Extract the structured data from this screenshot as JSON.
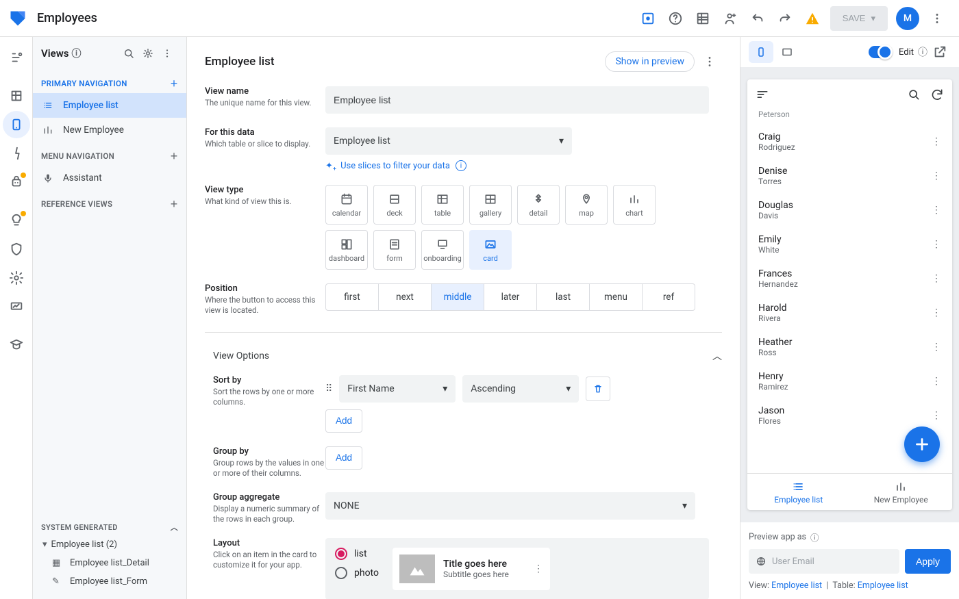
{
  "app": {
    "title": "Employees",
    "avatar_initial": "M",
    "save_label": "SAVE"
  },
  "views_panel": {
    "title": "Views",
    "sections": {
      "primary": {
        "title": "PRIMARY NAVIGATION",
        "items": [
          {
            "label": "Employee list",
            "icon": "list",
            "active": true
          },
          {
            "label": "New Employee",
            "icon": "chart",
            "active": false
          }
        ]
      },
      "menu": {
        "title": "MENU NAVIGATION",
        "items": [
          {
            "label": "Assistant",
            "icon": "mic"
          }
        ]
      },
      "ref": {
        "title": "REFERENCE VIEWS",
        "items": []
      },
      "sysgen": {
        "title": "SYSTEM GENERATED",
        "group_label": "Employee list (2)",
        "items": [
          {
            "label": "Employee list_Detail"
          },
          {
            "label": "Employee list_Form"
          }
        ]
      }
    }
  },
  "editor": {
    "title": "Employee list",
    "show_in_preview": "Show in preview",
    "fields": {
      "view_name": {
        "label": "View name",
        "hint": "The unique name for this view.",
        "value": "Employee list"
      },
      "for_data": {
        "label": "For this data",
        "hint": "Which table or slice to display.",
        "value": "Employee list",
        "slice_link": "Use slices to filter your data"
      },
      "view_type": {
        "label": "View type",
        "hint": "What kind of view this is.",
        "options": [
          "calendar",
          "deck",
          "table",
          "gallery",
          "detail",
          "map",
          "chart",
          "dashboard",
          "form",
          "onboarding",
          "card"
        ],
        "selected": "card"
      },
      "position": {
        "label": "Position",
        "hint": "Where the button to access this view is located.",
        "options": [
          "first",
          "next",
          "middle",
          "later",
          "last",
          "menu",
          "ref"
        ],
        "selected": "middle"
      }
    },
    "options_title": "View Options",
    "sort_by": {
      "label": "Sort by",
      "hint": "Sort the rows by one or more columns.",
      "column": "First Name",
      "direction": "Ascending",
      "add_label": "Add"
    },
    "group_by": {
      "label": "Group by",
      "hint": "Group rows by the values in one or more of their columns.",
      "add_label": "Add"
    },
    "group_agg": {
      "label": "Group aggregate",
      "hint": "Display a numeric summary of the rows in each group.",
      "value": "NONE"
    },
    "layout": {
      "label": "Layout",
      "hint": "Click on an item in the card to customize it for your app.",
      "radios": [
        "list",
        "photo"
      ],
      "selected": "list",
      "card_title": "Title goes here",
      "card_subtitle": "Subtitle goes here"
    }
  },
  "preview": {
    "edit_label": "Edit",
    "list": [
      {
        "first": "Peterson",
        "last": "",
        "partial": true
      },
      {
        "first": "Craig",
        "last": "Rodriguez"
      },
      {
        "first": "Denise",
        "last": "Torres"
      },
      {
        "first": "Douglas",
        "last": "Davis"
      },
      {
        "first": "Emily",
        "last": "White"
      },
      {
        "first": "Frances",
        "last": "Hernandez"
      },
      {
        "first": "Harold",
        "last": "Rivera"
      },
      {
        "first": "Heather",
        "last": "Ross"
      },
      {
        "first": "Henry",
        "last": "Ramirez"
      },
      {
        "first": "Jason",
        "last": "Flores"
      }
    ],
    "tabs": [
      {
        "label": "Employee list",
        "active": true
      },
      {
        "label": "New Employee",
        "active": false
      }
    ],
    "footer": {
      "preview_as": "Preview app as",
      "email_placeholder": "User Email",
      "apply": "Apply",
      "view_label": "View:",
      "view_value": "Employee list",
      "table_label": "Table:",
      "table_value": "Employee list"
    }
  }
}
